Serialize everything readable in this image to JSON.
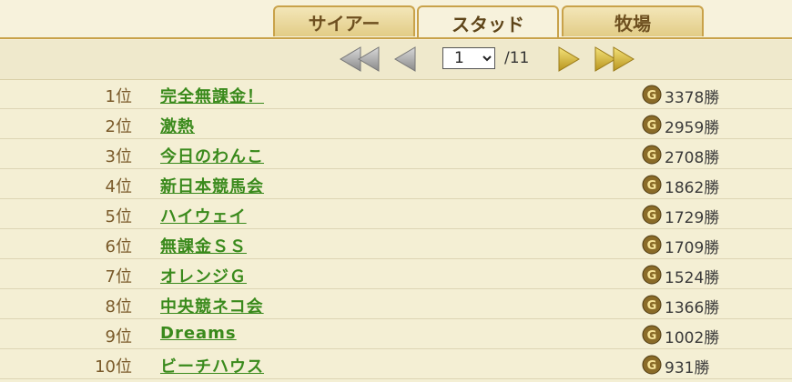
{
  "tabs": [
    {
      "label": "サイアー"
    },
    {
      "label": "スタッド"
    },
    {
      "label": "牧場"
    }
  ],
  "active_tab": "スタッド",
  "pager": {
    "current_page": "1",
    "total": "/11"
  },
  "icons": {
    "first": "double-left-arrow-icon",
    "prev": "left-arrow-icon",
    "next": "right-arrow-icon",
    "last": "double-right-arrow-icon",
    "grade": "g1-badge-icon"
  },
  "colors": {
    "accent_gold": "#c9a24a",
    "link_green": "#3a8a1c",
    "rank_brown": "#7a5a2a",
    "background": "#f4efd4"
  },
  "ranking": [
    {
      "rank": "1位",
      "name": "完全無課金！",
      "wins": "3378勝"
    },
    {
      "rank": "2位",
      "name": "激熱",
      "wins": "2959勝"
    },
    {
      "rank": "3位",
      "name": "今日のわんこ",
      "wins": "2708勝"
    },
    {
      "rank": "4位",
      "name": "新日本競馬会",
      "wins": "1862勝"
    },
    {
      "rank": "5位",
      "name": "ハイウェイ",
      "wins": "1729勝"
    },
    {
      "rank": "6位",
      "name": "無課金ＳＳ",
      "wins": "1709勝"
    },
    {
      "rank": "7位",
      "name": "オレンジＧ",
      "wins": "1524勝"
    },
    {
      "rank": "8位",
      "name": "中央競ネコ会",
      "wins": "1366勝"
    },
    {
      "rank": "9位",
      "name": "Dreams",
      "wins": "1002勝"
    },
    {
      "rank": "10位",
      "name": "ビーチハウス",
      "wins": "931勝"
    }
  ]
}
